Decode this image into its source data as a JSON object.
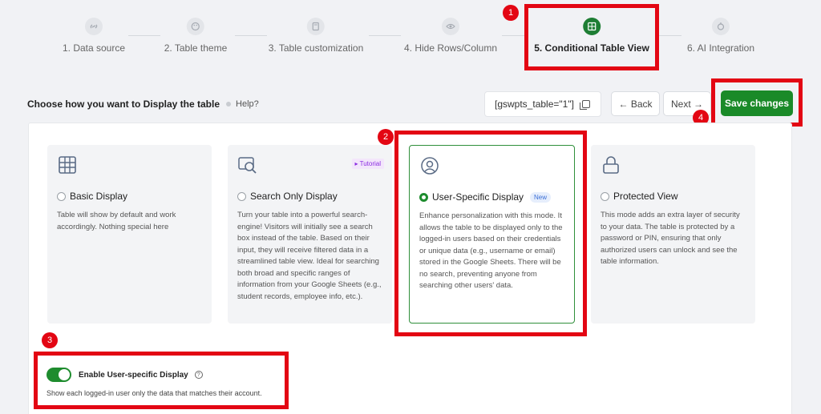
{
  "steps": [
    {
      "label": "1. Data source",
      "icon": "link-icon"
    },
    {
      "label": "2. Table theme",
      "icon": "palette-icon"
    },
    {
      "label": "3. Table customization",
      "icon": "calculator-icon"
    },
    {
      "label": "4. Hide Rows/Column",
      "icon": "eye-icon"
    },
    {
      "label": "5. Conditional Table View",
      "icon": "table-grid-icon"
    },
    {
      "label": "6. AI Integration",
      "icon": "ai-icon"
    }
  ],
  "annotations": [
    "1",
    "2",
    "3",
    "4"
  ],
  "toolbar": {
    "heading": "Choose how you want to Display the table",
    "help": "Help?",
    "shortcode": "[gswpts_table=\"1\"]",
    "back": "← Back",
    "next": "Next →",
    "save": "Save changes"
  },
  "cards": [
    {
      "title": "Basic Display",
      "desc": "Table will show by default and work accordingly. Nothing special here",
      "icon": "table-icon"
    },
    {
      "title": "Search Only Display",
      "tag": "▸ Tutorial",
      "desc": "Turn your table into a powerful search-engine! Visitors will initially see a search box instead of the table. Based on their input, they will receive filtered data in a streamlined table view. Ideal for searching both broad and specific ranges of information from your Google Sheets (e.g., student records, employee info, etc.).",
      "icon": "search-icon"
    },
    {
      "title": "User-Specific Display",
      "tag": "New",
      "desc": "Enhance personalization with this mode. It allows the table to be displayed only to the logged-in users based on their credentials or unique data (e.g., username or email) stored in the Google Sheets. There will be no search, preventing anyone from searching other users' data.",
      "icon": "user-target-icon"
    },
    {
      "title": "Protected View",
      "desc": "This mode adds an extra layer of security to your data. The table is protected by a password or PIN, ensuring that only authorized users can unlock and see the table information.",
      "icon": "lock-icon"
    }
  ],
  "user_specific": {
    "label": "Enable User-specific Display",
    "desc": "Show each logged-in user only the data that matches their account.",
    "enabled": true
  },
  "colors": {
    "accent": "#1e8c2e",
    "highlight": "#e30613"
  }
}
